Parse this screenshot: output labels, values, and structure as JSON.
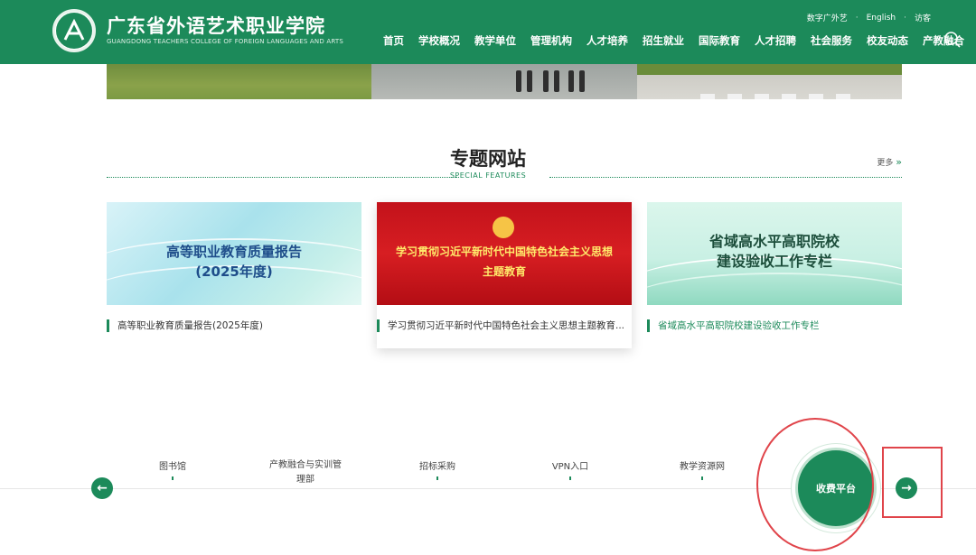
{
  "header": {
    "brand_cn": "广东省外语艺术职业学院",
    "brand_en": "GUANGDONG TEACHERS COLLEGE OF FOREIGN LANGUAGES AND ARTS",
    "toplinks": [
      "数字广外艺",
      "English",
      "访客"
    ],
    "nav": [
      "首页",
      "学校概况",
      "教学单位",
      "管理机构",
      "人才培养",
      "招生就业",
      "国际教育",
      "人才招聘",
      "社会服务",
      "校友动态",
      "产教融合"
    ],
    "accent_color": "#1c8a5a"
  },
  "section": {
    "title": "专题网站",
    "subtitle": "SPECIAL FEATURES",
    "more_label": "更多",
    "more_icon": "double-chevron-right-icon"
  },
  "cards": [
    {
      "image_title_line1": "高等职业教育质量报告",
      "image_title_line2": "(2025年度)",
      "caption": "高等职业教育质量报告(2025年度)"
    },
    {
      "image_title_line1": "学习贯彻习近平新时代中国特色社会主义思想",
      "image_title_line2": "主题教育",
      "caption": "学习贯彻习近平新时代中国特色社会主义思想主题教育..."
    },
    {
      "image_title_line1": "省域高水平高职院校",
      "image_title_line2": "建设验收工作专栏",
      "caption": "省域高水平高职院校建设验收工作专栏"
    }
  ],
  "quick_links": {
    "items": [
      "图书馆",
      "产教融合与实训管理部",
      "招标采购",
      "VPN入口",
      "教学资源网"
    ],
    "featured": "收费平台",
    "prev_icon": "arrow-left-icon",
    "next_icon": "arrow-right-icon"
  }
}
